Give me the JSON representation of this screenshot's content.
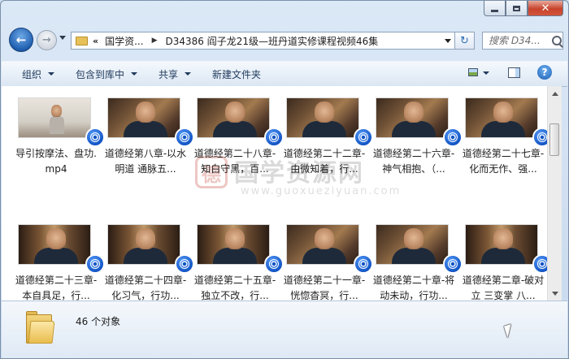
{
  "window": {
    "minimize_glyph": "—",
    "close_glyph": "✕"
  },
  "nav": {
    "back_glyph": "←",
    "forward_glyph": "→",
    "address_chevron": "«",
    "breadcrumb": [
      "国学资...",
      "D34386 阎子龙21级—班丹道实修课程视频46集"
    ],
    "refresh_glyph": "↻",
    "search_placeholder": "搜索 D34..."
  },
  "toolbar": {
    "items": [
      "组织",
      "包含到库中",
      "共享",
      "新建文件夹"
    ],
    "help_glyph": "?"
  },
  "files": [
    {
      "label": "导引按摩法、盘功.mp4",
      "thumb": "light"
    },
    {
      "label": "道德经第八章-以水明道 通脉五...",
      "thumb": "dark"
    },
    {
      "label": "道德经第二十八章-知白守黑，百...",
      "thumb": "dark"
    },
    {
      "label": "道德经第二十二章-由微知着，行...",
      "thumb": "dark"
    },
    {
      "label": "道德经第二十六章-神气相抱、（...",
      "thumb": "dark"
    },
    {
      "label": "道德经第二十七章-化而无作、强...",
      "thumb": "dark"
    },
    {
      "label": "道德经第二十三章-本自具足，行...",
      "thumb": "shelf"
    },
    {
      "label": "道德经第二十四章-化习气，行功...",
      "thumb": "shelf"
    },
    {
      "label": "道德经第二十五章-独立不改，行...",
      "thumb": "shelf"
    },
    {
      "label": "道德经第二十一章-恍惚杳冥，行...",
      "thumb": "dark"
    },
    {
      "label": "道德经第二十章-将动未动，行功...",
      "thumb": "dark"
    },
    {
      "label": "道德经第二章-破对立 三变掌 八...",
      "thumb": "shelf"
    }
  ],
  "watermark": {
    "seal": "德",
    "text": "国学资源网",
    "url": "www.guoxueziyuan.com"
  },
  "details": {
    "count": "46 个对象"
  },
  "colors": {
    "accent": "#1254c4",
    "close": "#c7432c",
    "folder": "#e9bd4e"
  }
}
